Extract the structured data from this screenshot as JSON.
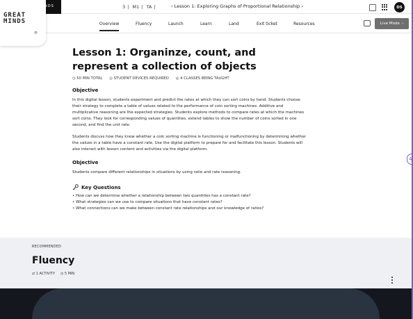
{
  "topbar": {
    "brand_mini": "NDS",
    "crumb_grade": "3",
    "crumb_module": "M1",
    "crumb_topic": "TA",
    "lesson_nav": "‹  Lesson 1: Exploring Graphs of Proportional Relationship  ›",
    "avatar_initials": "DS"
  },
  "logo": {
    "line1": "GREAT",
    "line2": "MINDS",
    "reg": "®"
  },
  "subnav": {
    "tabs": [
      "Overview",
      "Fluency",
      "Launch",
      "Learn",
      "Land",
      "Exit ticket",
      "Resources"
    ],
    "live_mode": "Live Mode",
    "live_arrow": "›"
  },
  "lesson": {
    "title": "Lesson 1: Organinze, count, and represent a collection of objects",
    "meta_time": "◷ 50 MIN TOTAL",
    "meta_devices": "◎ STUDENT DEVICES REQUIRED",
    "meta_classes": "◎ 4 CLASSES BEING TAUGHT",
    "objective1_heading": "Objective",
    "objective1_p1": "In this digital lesson, students experiment and predict the rates at which they can sort coins by hand. Students choose their strategy to complete a table of values related to the performance of coin sorting machines. Additive and multiplicative reasoning are the expected strategies. Students explore methods to compare rates at which the machines sort coins. They look for corresponding values of quantities, extend tables to show the number of coins sorted in one second, and find the unit rate.",
    "objective1_p2": "Students discuss how they know whether a coin sorting machine is functioning or malfunctioning by determining whether the values in a table have a constant rate. Use the digital platform to prepare for and facilitate this lesson. Students will also interact with lesson content and activities via the digital platform.",
    "objective2_heading": "Objective",
    "objective2_p": "Students compare different relationships in situations by using ratio and rate reasoning.",
    "key_questions_heading": "Key Questions",
    "key_questions": [
      "• How can we determine whether a relationship between two quantities has a constant rate?",
      "• What strategies can we use to compare situations that have constant rates?",
      "• What connections can we make between constant rate relationships and our knowledge of ratios?"
    ]
  },
  "recommended": {
    "label": "RECOMMENDED",
    "title": "Fluency",
    "activity": "⇄ 1 ACTIVITY",
    "time": "◷ 5 MIN"
  },
  "side_tab": "4"
}
